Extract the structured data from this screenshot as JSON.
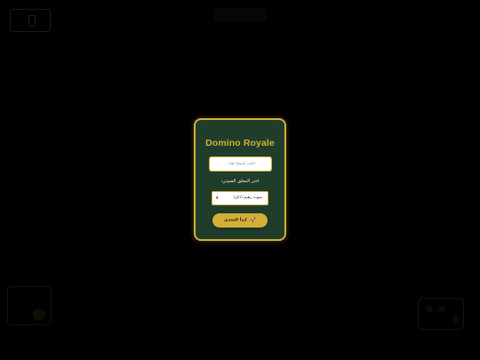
{
  "modal": {
    "title": "Domino Royale",
    "name_placeholder": "اكتب اسمك هنا...",
    "name_value": "",
    "voice_label": "اختر المعلق الصوتي:",
    "voice_selected": "صوت رهيم (ذكر)",
    "start_label": "ابدأ التحدي",
    "start_icon": "rocket-icon"
  },
  "colors": {
    "accent": "#d4af37",
    "panel": "#1f3d2a",
    "background": "#000000"
  }
}
